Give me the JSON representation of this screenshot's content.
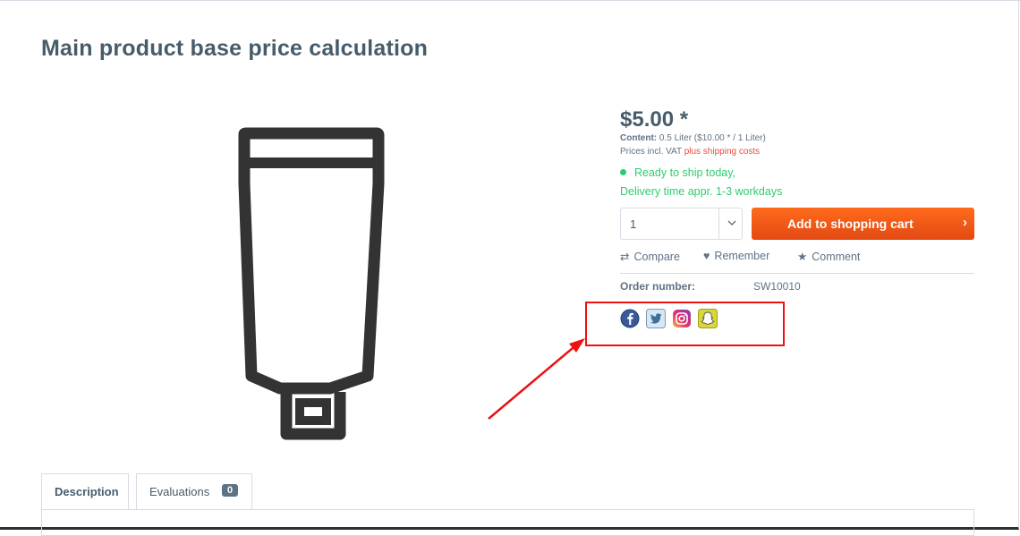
{
  "product": {
    "title": "Main product base price calculation"
  },
  "buybox": {
    "price": "$5.00 *",
    "content_label": "Content:",
    "content_value": "0.5 Liter ($10.00 * / 1 Liter)",
    "vat_text": "Prices incl. VAT",
    "shipping_link": "plus shipping costs",
    "delivery_status": "Ready to ship today,",
    "delivery_time": "Delivery time appr. 1-3 workdays",
    "quantity": "1",
    "add_to_cart": "Add to shopping cart",
    "add_to_cart_icon": "chevron-right-icon"
  },
  "actions": {
    "compare": "Compare",
    "remember": "Remember",
    "comment": "Comment"
  },
  "order": {
    "label": "Order number:",
    "number": "SW10010"
  },
  "social": [
    "facebook-icon",
    "twitter-icon",
    "instagram-icon",
    "snapchat-icon"
  ],
  "tabs": [
    {
      "label": "Description"
    },
    {
      "label": "Evaluations",
      "badge": "0"
    }
  ],
  "colors": {
    "accent": "#e74c3c",
    "cart_button": "#f25a17",
    "success": "#2ecc71",
    "text": "#5f7285",
    "heading": "#475c6a",
    "annotation": "#ee1111"
  }
}
